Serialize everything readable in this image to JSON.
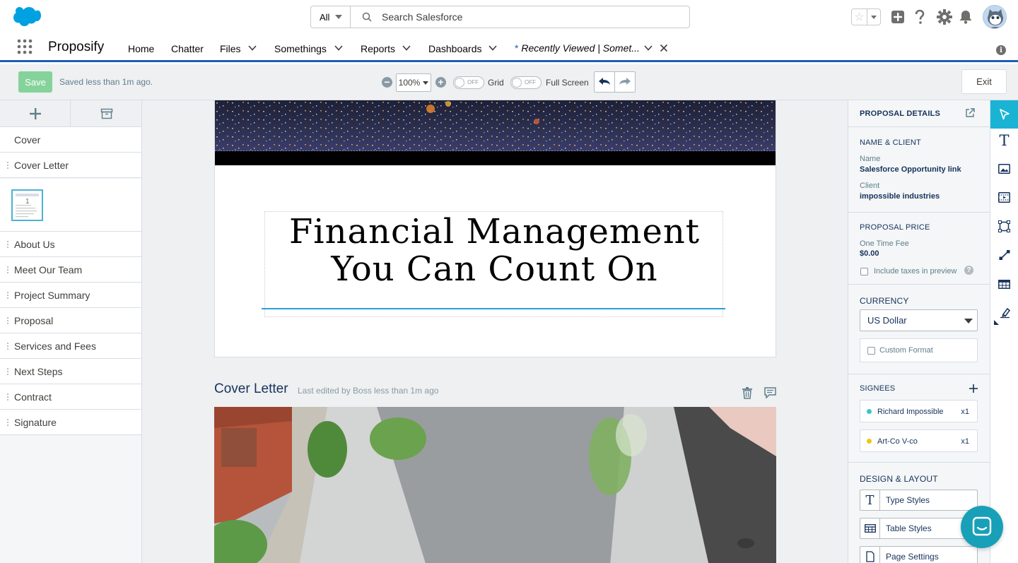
{
  "header": {
    "search_scope": "All",
    "search_placeholder": "Search Salesforce"
  },
  "app": {
    "name": "Proposify",
    "nav": [
      {
        "label": "Home"
      },
      {
        "label": "Chatter"
      },
      {
        "label": "Files"
      },
      {
        "label": "Somethings"
      },
      {
        "label": "Reports"
      },
      {
        "label": "Dashboards"
      }
    ],
    "recent_tab_star": "*",
    "recent_tab": "Recently Viewed | Somet..."
  },
  "toolbar": {
    "save_label": "Save",
    "save_status": "Saved less than 1m ago.",
    "zoom": "100%",
    "grid_toggle_state": "OFF",
    "grid_label": "Grid",
    "fullscreen_toggle_state": "OFF",
    "fullscreen_label": "Full Screen",
    "exit_label": "Exit"
  },
  "sidebar": {
    "sections": [
      {
        "label": "Cover"
      },
      {
        "label": "Cover Letter"
      },
      {
        "label": "About Us"
      },
      {
        "label": "Meet Our Team"
      },
      {
        "label": "Project Summary"
      },
      {
        "label": "Proposal"
      },
      {
        "label": "Services and Fees"
      },
      {
        "label": "Next Steps"
      },
      {
        "label": "Contract"
      },
      {
        "label": "Signature"
      }
    ],
    "thumb_page_number": "1"
  },
  "canvas": {
    "cover_title_line1": "Financial Management",
    "cover_title_line2": "You Can Count On",
    "cover_letter_heading": "Cover Letter",
    "cover_letter_meta": "Last edited by Boss less than 1m ago"
  },
  "panel": {
    "title": "PROPOSAL DETAILS",
    "name_client_heading": "NAME & CLIENT",
    "name_label": "Name",
    "name_value": "Salesforce Opportunity link",
    "client_label": "Client",
    "client_value": "impossible industries",
    "price_heading": "PROPOSAL PRICE",
    "fee_label": "One Time Fee",
    "fee_value": "$0.00",
    "include_taxes_label": "Include taxes in preview",
    "currency_heading": "CURRENCY",
    "currency_value": "US Dollar",
    "custom_format_label": "Custom Format",
    "signees_heading": "SIGNEES",
    "signees": [
      {
        "name": "Richard Impossible",
        "count": "x1",
        "color": "#3bc5c9"
      },
      {
        "name": "Art-Co V-co",
        "count": "x1",
        "color": "#f0c419"
      }
    ],
    "design_heading": "DESIGN & LAYOUT",
    "design_buttons": [
      {
        "label": "Type Styles"
      },
      {
        "label": "Table Styles"
      },
      {
        "label": "Page Settings"
      }
    ]
  },
  "colors": {
    "brand_blue": "#1b5fb6",
    "save_green": "#85d39a",
    "accent_teal": "#1ab3d4",
    "heading_navy": "#16325c"
  }
}
